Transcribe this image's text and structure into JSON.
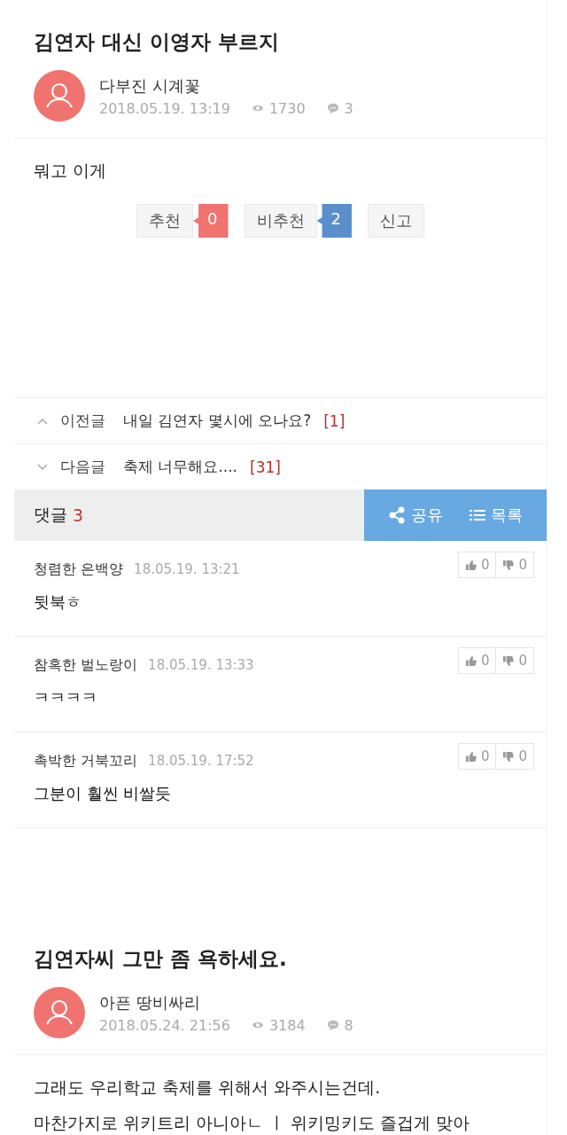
{
  "posts": [
    {
      "title": "김연자 대신 이영자 부르지",
      "author": "다부진 시계꽃",
      "date": "2018.05.19. 13:19",
      "views": "1730",
      "comment_count": "3",
      "body": [
        "뭐고 이게"
      ],
      "votes": [
        {
          "label": "추천",
          "count": "0",
          "color": "#f07370"
        },
        {
          "label": "비추천",
          "count": "2",
          "color": "#5b8fcc"
        }
      ],
      "report": "신고",
      "nav": [
        {
          "kind": "prev",
          "label": "이전글",
          "title": "내일 김연자 몇시에 오나요?",
          "count": "[1]"
        },
        {
          "kind": "next",
          "label": "다음글",
          "title": "축제 너무해요....",
          "count": "[31]"
        }
      ],
      "comments_bar": {
        "label": "댓글",
        "count": "3",
        "share": "공유",
        "list": "목록"
      },
      "comments": [
        {
          "author": "청렴한 은백양",
          "date": "18.05.19. 13:21",
          "text": "뒷북ㅎ",
          "likes": "0",
          "dislikes": "0"
        },
        {
          "author": "참혹한 벌노랑이",
          "date": "18.05.19. 13:33",
          "text": "ㅋㅋㅋㅋ",
          "likes": "0",
          "dislikes": "0"
        },
        {
          "author": "촉박한 거북꼬리",
          "date": "18.05.19. 17:52",
          "text": "그분이 훨씬 비쌀듯",
          "likes": "0",
          "dislikes": "0"
        }
      ]
    },
    {
      "title": "김연자씨 그만 좀 욕하세요.",
      "author": "아픈 땅비싸리",
      "date": "2018.05.24. 21:56",
      "views": "3184",
      "comment_count": "8",
      "body": [
        "그래도 우리학교 축제를 위해서 와주시는건데.",
        "마찬가지로 위키트리 아니아ㄴ ㅣ 위키밍키도 즐겁게 맞아"
      ]
    }
  ]
}
